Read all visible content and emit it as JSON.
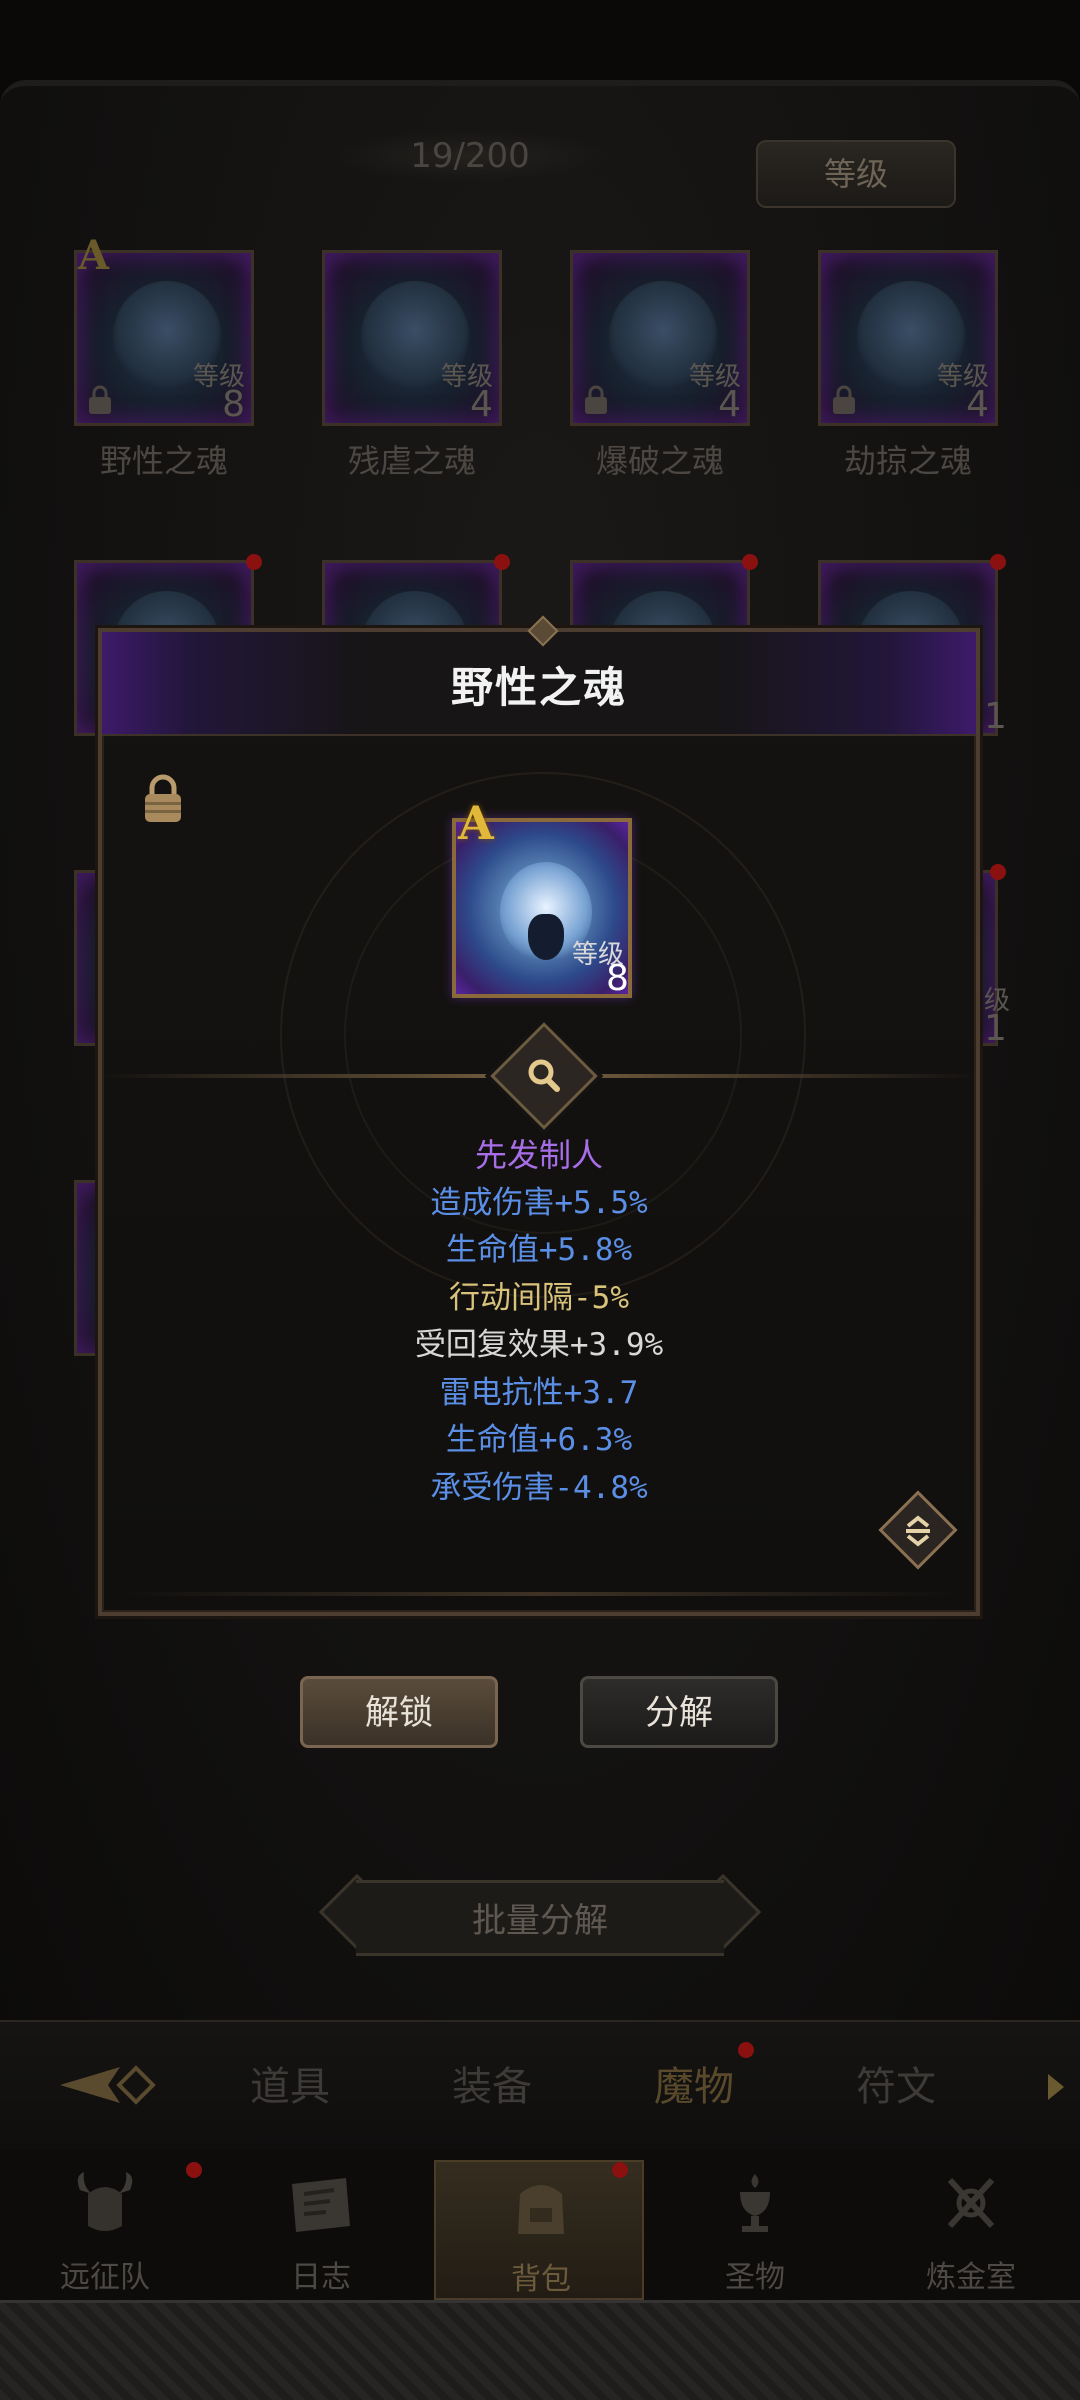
{
  "header": {
    "count": "19/200",
    "sort_label": "等级"
  },
  "grid": {
    "row1": [
      {
        "name": "野性之魂",
        "level_label": "等级",
        "level": "8",
        "rank": "A",
        "locked": true
      },
      {
        "name": "残虐之魂",
        "level_label": "等级",
        "level": "4",
        "rank": "",
        "locked": false
      },
      {
        "name": "爆破之魂",
        "level_label": "等级",
        "level": "4",
        "rank": "",
        "locked": true
      },
      {
        "name": "劫掠之魂",
        "level_label": "等级",
        "level": "4",
        "rank": "",
        "locked": true
      }
    ],
    "side_fragments": [
      "1",
      "级",
      "1"
    ]
  },
  "detail": {
    "title": "野性之魂",
    "rank": "A",
    "level_label": "等级",
    "level": "8",
    "attributes": [
      {
        "text": "先发制人",
        "color": "#a86ee8"
      },
      {
        "text": "造成伤害+5.5%",
        "color": "#5b8fe6"
      },
      {
        "text": "生命值+5.8%",
        "color": "#5b8fe6"
      },
      {
        "text": "行动间隔-5%",
        "color": "#d9c27a"
      },
      {
        "text": "受回复效果+3.9%",
        "color": "#d8d8d8"
      },
      {
        "text": "雷电抗性+3.7",
        "color": "#5b8fe6"
      },
      {
        "text": "生命值+6.3%",
        "color": "#5b8fe6"
      },
      {
        "text": "承受伤害-4.8%",
        "color": "#5b8fe6"
      }
    ]
  },
  "actions": {
    "unlock": "解锁",
    "decompose": "分解",
    "batch_decompose": "批量分解"
  },
  "categories": [
    {
      "label": "道具",
      "active": false
    },
    {
      "label": "装备",
      "active": false
    },
    {
      "label": "魔物",
      "active": true
    },
    {
      "label": "符文",
      "active": false
    }
  ],
  "nav": [
    {
      "label": "远征队",
      "icon": "horned-helmet-icon",
      "active": false
    },
    {
      "label": "日志",
      "icon": "map-scroll-icon",
      "active": false
    },
    {
      "label": "背包",
      "icon": "backpack-icon",
      "active": true
    },
    {
      "label": "圣物",
      "icon": "grail-icon",
      "active": false
    },
    {
      "label": "炼金室",
      "icon": "alchemy-icon",
      "active": false
    }
  ]
}
